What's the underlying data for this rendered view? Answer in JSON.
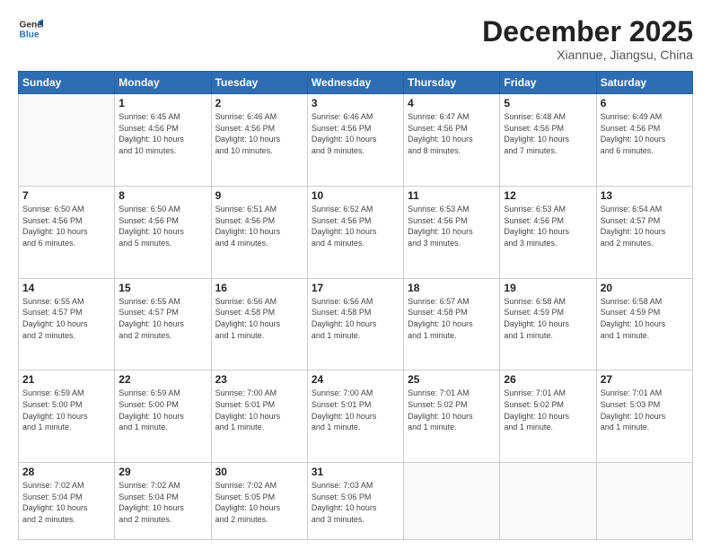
{
  "header": {
    "logo_line1": "General",
    "logo_line2": "Blue",
    "month": "December 2025",
    "location": "Xiannue, Jiangsu, China"
  },
  "weekdays": [
    "Sunday",
    "Monday",
    "Tuesday",
    "Wednesday",
    "Thursday",
    "Friday",
    "Saturday"
  ],
  "weeks": [
    [
      {
        "day": "",
        "info": ""
      },
      {
        "day": "1",
        "info": "Sunrise: 6:45 AM\nSunset: 4:56 PM\nDaylight: 10 hours\nand 10 minutes."
      },
      {
        "day": "2",
        "info": "Sunrise: 6:46 AM\nSunset: 4:56 PM\nDaylight: 10 hours\nand 10 minutes."
      },
      {
        "day": "3",
        "info": "Sunrise: 6:46 AM\nSunset: 4:56 PM\nDaylight: 10 hours\nand 9 minutes."
      },
      {
        "day": "4",
        "info": "Sunrise: 6:47 AM\nSunset: 4:56 PM\nDaylight: 10 hours\nand 8 minutes."
      },
      {
        "day": "5",
        "info": "Sunrise: 6:48 AM\nSunset: 4:56 PM\nDaylight: 10 hours\nand 7 minutes."
      },
      {
        "day": "6",
        "info": "Sunrise: 6:49 AM\nSunset: 4:56 PM\nDaylight: 10 hours\nand 6 minutes."
      }
    ],
    [
      {
        "day": "7",
        "info": "Sunrise: 6:50 AM\nSunset: 4:56 PM\nDaylight: 10 hours\nand 6 minutes."
      },
      {
        "day": "8",
        "info": "Sunrise: 6:50 AM\nSunset: 4:56 PM\nDaylight: 10 hours\nand 5 minutes."
      },
      {
        "day": "9",
        "info": "Sunrise: 6:51 AM\nSunset: 4:56 PM\nDaylight: 10 hours\nand 4 minutes."
      },
      {
        "day": "10",
        "info": "Sunrise: 6:52 AM\nSunset: 4:56 PM\nDaylight: 10 hours\nand 4 minutes."
      },
      {
        "day": "11",
        "info": "Sunrise: 6:53 AM\nSunset: 4:56 PM\nDaylight: 10 hours\nand 3 minutes."
      },
      {
        "day": "12",
        "info": "Sunrise: 6:53 AM\nSunset: 4:56 PM\nDaylight: 10 hours\nand 3 minutes."
      },
      {
        "day": "13",
        "info": "Sunrise: 6:54 AM\nSunset: 4:57 PM\nDaylight: 10 hours\nand 2 minutes."
      }
    ],
    [
      {
        "day": "14",
        "info": "Sunrise: 6:55 AM\nSunset: 4:57 PM\nDaylight: 10 hours\nand 2 minutes."
      },
      {
        "day": "15",
        "info": "Sunrise: 6:55 AM\nSunset: 4:57 PM\nDaylight: 10 hours\nand 2 minutes."
      },
      {
        "day": "16",
        "info": "Sunrise: 6:56 AM\nSunset: 4:58 PM\nDaylight: 10 hours\nand 1 minute."
      },
      {
        "day": "17",
        "info": "Sunrise: 6:56 AM\nSunset: 4:58 PM\nDaylight: 10 hours\nand 1 minute."
      },
      {
        "day": "18",
        "info": "Sunrise: 6:57 AM\nSunset: 4:58 PM\nDaylight: 10 hours\nand 1 minute."
      },
      {
        "day": "19",
        "info": "Sunrise: 6:58 AM\nSunset: 4:59 PM\nDaylight: 10 hours\nand 1 minute."
      },
      {
        "day": "20",
        "info": "Sunrise: 6:58 AM\nSunset: 4:59 PM\nDaylight: 10 hours\nand 1 minute."
      }
    ],
    [
      {
        "day": "21",
        "info": "Sunrise: 6:59 AM\nSunset: 5:00 PM\nDaylight: 10 hours\nand 1 minute."
      },
      {
        "day": "22",
        "info": "Sunrise: 6:59 AM\nSunset: 5:00 PM\nDaylight: 10 hours\nand 1 minute."
      },
      {
        "day": "23",
        "info": "Sunrise: 7:00 AM\nSunset: 5:01 PM\nDaylight: 10 hours\nand 1 minute."
      },
      {
        "day": "24",
        "info": "Sunrise: 7:00 AM\nSunset: 5:01 PM\nDaylight: 10 hours\nand 1 minute."
      },
      {
        "day": "25",
        "info": "Sunrise: 7:01 AM\nSunset: 5:02 PM\nDaylight: 10 hours\nand 1 minute."
      },
      {
        "day": "26",
        "info": "Sunrise: 7:01 AM\nSunset: 5:02 PM\nDaylight: 10 hours\nand 1 minute."
      },
      {
        "day": "27",
        "info": "Sunrise: 7:01 AM\nSunset: 5:03 PM\nDaylight: 10 hours\nand 1 minute."
      }
    ],
    [
      {
        "day": "28",
        "info": "Sunrise: 7:02 AM\nSunset: 5:04 PM\nDaylight: 10 hours\nand 2 minutes."
      },
      {
        "day": "29",
        "info": "Sunrise: 7:02 AM\nSunset: 5:04 PM\nDaylight: 10 hours\nand 2 minutes."
      },
      {
        "day": "30",
        "info": "Sunrise: 7:02 AM\nSunset: 5:05 PM\nDaylight: 10 hours\nand 2 minutes."
      },
      {
        "day": "31",
        "info": "Sunrise: 7:03 AM\nSunset: 5:06 PM\nDaylight: 10 hours\nand 3 minutes."
      },
      {
        "day": "",
        "info": ""
      },
      {
        "day": "",
        "info": ""
      },
      {
        "day": "",
        "info": ""
      }
    ]
  ]
}
